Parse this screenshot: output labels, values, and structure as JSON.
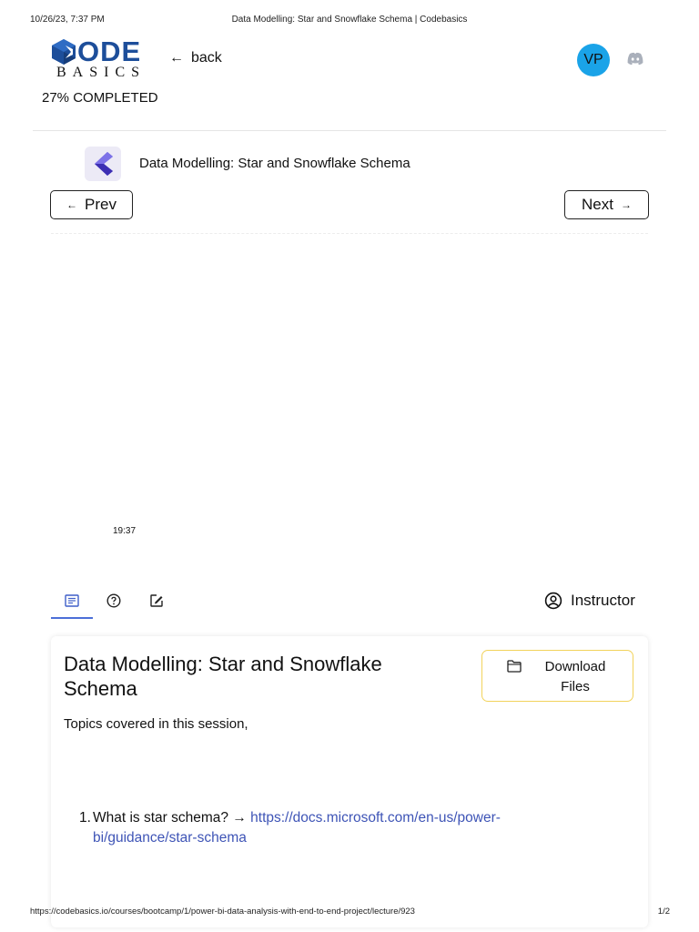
{
  "print": {
    "date": "10/26/23, 7:37 PM",
    "title": "Data Modelling: Star and Snowflake Schema | Codebasics",
    "url": "https://codebasics.io/courses/bootcamp/1/power-bi-data-analysis-with-end-to-end-project/lecture/923",
    "page": "1/2"
  },
  "header": {
    "logo_code": "ODE",
    "logo_basics": "BASICS",
    "back_label": "back",
    "progress": "27% COMPLETED",
    "progress_value": 0.27,
    "avatar_initials": "VP",
    "avatar_color": "#1aa3e8"
  },
  "lecture": {
    "title": "Data Modelling: Star and Snowflake Schema",
    "prev_label": "Prev",
    "next_label": "Next",
    "video_time": "19:37"
  },
  "tabs": {
    "items": [
      "notes-icon",
      "help-icon",
      "edit-icon"
    ],
    "active": 0,
    "instructor_label": "Instructor",
    "accent": "#4c6fd8"
  },
  "content": {
    "title": "Data Modelling: Star and Snowflake Schema",
    "download_label": "Download Files",
    "topics_intro": "Topics covered in this session,",
    "items": [
      {
        "number": "1.",
        "text": "What is star schema? → ",
        "link": "https://docs.microsoft.com/en-us/power-bi/guidance/star-schema"
      }
    ],
    "link_color": "#3e54b6",
    "download_border_color": "#f2d35c"
  }
}
